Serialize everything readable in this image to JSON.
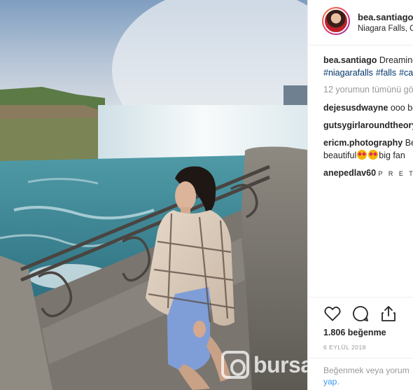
{
  "post": {
    "username": "bea.santiago",
    "location": "Niagara Falls, Ontario",
    "caption": "Dreaming",
    "hashtags": [
      "#niagarafalls",
      "#falls",
      "#canada"
    ],
    "load_more": "12 yorumun tümünü gör",
    "comments": [
      {
        "user": "dejesusdwayne",
        "text": "ooo bea"
      },
      {
        "user": "gutsygirlaroundtheory",
        "text": ""
      },
      {
        "user": "ericm.photography",
        "text": "Be",
        "text2_prefix": "beautiful",
        "text2_suffix": "big fan"
      },
      {
        "user": "anepedlav60",
        "text": "P R E T T Y"
      }
    ],
    "likes": "1.806 beğenme",
    "date": "6 EYLÜL 2018",
    "add_comment_placeholder": "Beğenmek veya yorum",
    "add_comment_action": "yap."
  },
  "watermark": "bursa",
  "icons": {
    "like": "heart-icon",
    "comment": "comment-bubble-icon",
    "share": "share-icon",
    "emoji": "heart-eyes-emoji"
  },
  "colors": {
    "link": "#003569",
    "muted": "#999999",
    "text": "#262626",
    "accent": "#3897f0"
  }
}
